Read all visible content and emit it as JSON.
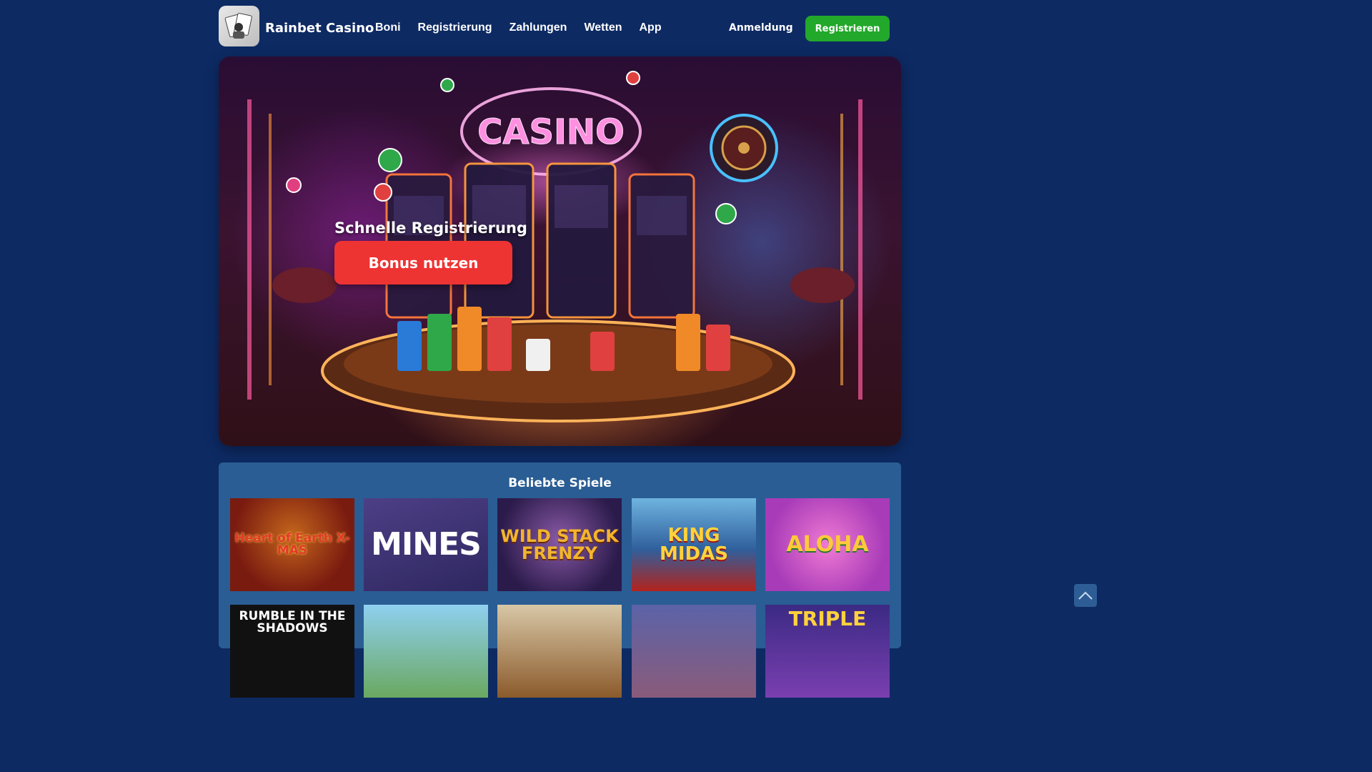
{
  "header": {
    "brand": "Rainbet Casino",
    "nav": [
      "Boni",
      "Registrierung",
      "Zahlungen",
      "Wetten",
      "App"
    ],
    "login_label": "Anmeldung",
    "signup_label": "Registrieren"
  },
  "hero": {
    "title": "Schnelle Registrierung",
    "cta_label": "Bonus nutzen",
    "sign_text": "CASINO"
  },
  "games": {
    "title": "Beliebte Spiele",
    "tiles": [
      "Heart of Earth X-MAS",
      "MINES",
      "WILD STACK FRENZY",
      "KING MIDAS",
      "ALOHA",
      "RUMBLE IN THE SHADOWS",
      "",
      "",
      "",
      "TRIPLE"
    ]
  },
  "colors": {
    "page_bg": "#0d2a63",
    "panel_bg": "#2a5d93",
    "signup_green": "#22a82a",
    "cta_red": "#ee3333"
  },
  "icons": {
    "scroll_top": "chevron-up-icon"
  }
}
